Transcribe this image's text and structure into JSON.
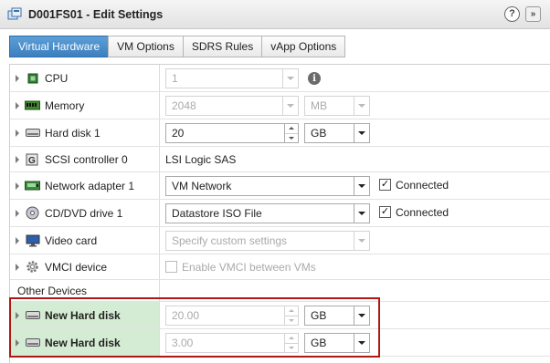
{
  "window": {
    "title": "D001FS01 - Edit Settings",
    "help_label": "?",
    "menu_label": "»"
  },
  "tabs": [
    {
      "label": "Virtual Hardware",
      "active": true
    },
    {
      "label": "VM Options",
      "active": false
    },
    {
      "label": "SDRS Rules",
      "active": false
    },
    {
      "label": "vApp Options",
      "active": false
    }
  ],
  "hardware": {
    "cpu": {
      "label": "CPU",
      "value": "1",
      "icon": "cpu-icon"
    },
    "memory": {
      "label": "Memory",
      "value": "2048",
      "unit": "MB",
      "icon": "memory-icon"
    },
    "hard_disk_1": {
      "label": "Hard disk 1",
      "value": "20",
      "unit": "GB",
      "icon": "hard-disk-icon"
    },
    "scsi": {
      "label": "SCSI controller 0",
      "value": "LSI Logic SAS",
      "icon": "scsi-controller-icon"
    },
    "network": {
      "label": "Network adapter 1",
      "value": "VM Network",
      "connected_label": "Connected",
      "connected": true,
      "icon": "network-adapter-icon"
    },
    "cdrom": {
      "label": "CD/DVD drive 1",
      "value": "Datastore ISO File",
      "connected_label": "Connected",
      "connected": true,
      "icon": "cd-dvd-icon"
    },
    "video": {
      "label": "Video card",
      "value": "Specify custom settings",
      "icon": "video-card-icon"
    },
    "vmci": {
      "label": "VMCI device",
      "value": "Enable VMCI between VMs",
      "checked": false,
      "icon": "vmci-gear-icon"
    },
    "other": {
      "label": "Other Devices"
    },
    "new_disk_1": {
      "label": "New Hard disk",
      "value": "20.00",
      "unit": "GB",
      "icon": "hard-disk-icon"
    },
    "new_disk_2": {
      "label": "New Hard disk",
      "value": "3.00",
      "unit": "GB",
      "icon": "hard-disk-icon"
    }
  },
  "colors": {
    "active_tab": "#3b7fc0",
    "highlight_row": "#d5ecd4",
    "callout_border": "#b01818"
  }
}
